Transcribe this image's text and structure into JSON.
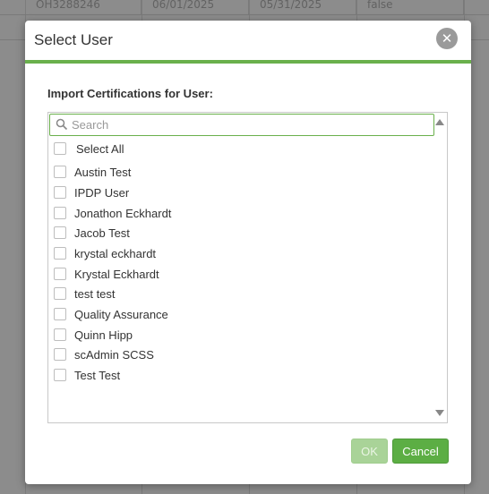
{
  "background": {
    "row": [
      "OH3288246",
      "06/01/2025",
      "05/31/2025",
      "false"
    ]
  },
  "dialog": {
    "title": "Select User",
    "close_icon": "close-icon",
    "field_label": "Import Certifications for User:",
    "search": {
      "placeholder": "Search",
      "value": ""
    },
    "select_all_label": "Select All",
    "users": [
      "Austin Test",
      "IPDP User",
      "Jonathon Eckhardt",
      "Jacob Test",
      "krystal eckhardt",
      "Krystal Eckhardt",
      "test test",
      "Quality Assurance",
      "Quinn Hipp",
      "scAdmin SCSS",
      "Test Test"
    ],
    "ok_label": "OK",
    "cancel_label": "Cancel"
  },
  "colors": {
    "accent": "#6ab04c",
    "button_primary": "#5cae44",
    "button_disabled": "#a9d398"
  }
}
